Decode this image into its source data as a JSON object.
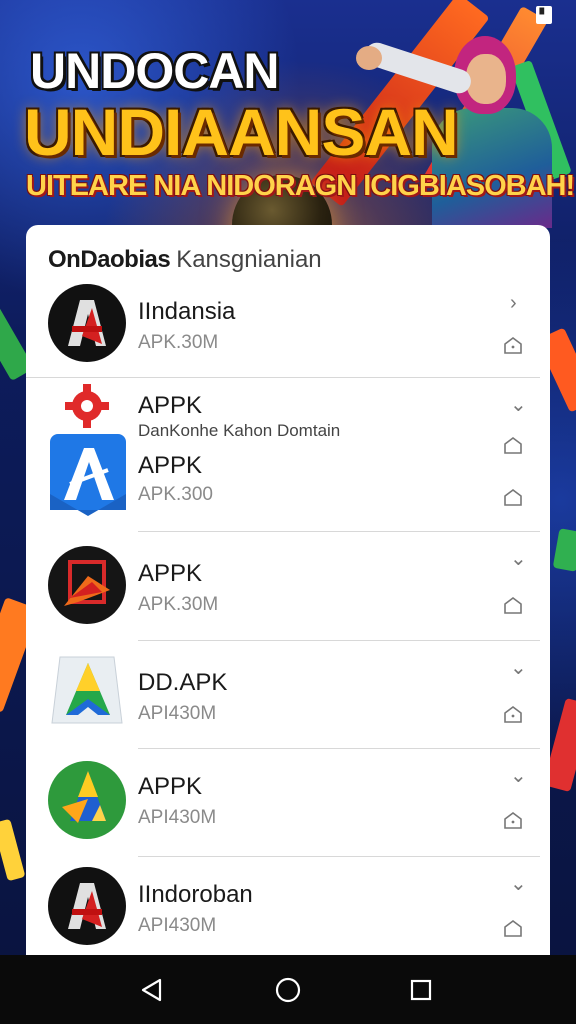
{
  "banner": {
    "title_line1": "UNDOCAN",
    "title_line2": "UNDIAANSAN",
    "subtitle": "UITEARE NIA NIDORAGN ICIGBIASOBAH!"
  },
  "card": {
    "title_part1": "OnDaobias",
    "title_part2": "Kansgnianian"
  },
  "apps": [
    {
      "name": "IIndansia",
      "size": "APK.30M",
      "icon": "app-icon-black-red"
    },
    {
      "name": "APPK",
      "description": "DanKonhe Kahon Domtain",
      "icon": "app-icon-red-gear"
    },
    {
      "name": "APPK",
      "size": "APK.300",
      "icon": "app-icon-blue-a"
    },
    {
      "name": "APPK",
      "size": "APK.30M",
      "icon": "app-icon-black-arrow"
    },
    {
      "name": "DD.APK",
      "size": "API430M",
      "icon": "app-icon-green-a"
    },
    {
      "name": "APPK",
      "size": "API430M",
      "icon": "app-icon-green-circle"
    },
    {
      "name": "IIndoroban",
      "size": "API430M",
      "icon": "app-icon-black-red"
    }
  ],
  "nav": {
    "back": "back-icon",
    "home": "home-icon",
    "recents": "recents-icon"
  },
  "colors": {
    "headline_gold": "#ffc21a",
    "card_bg": "#ffffff",
    "nav_bg": "#0a0a0a"
  }
}
